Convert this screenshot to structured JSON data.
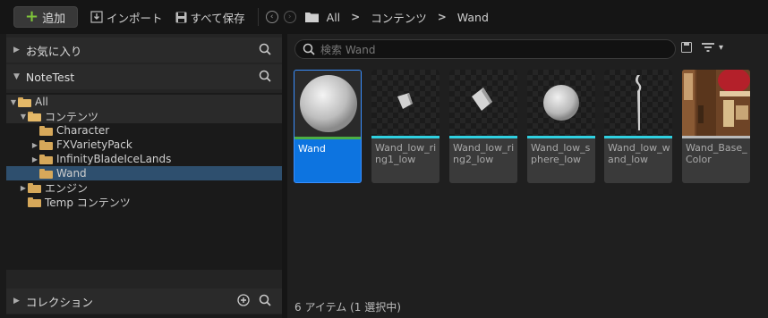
{
  "toolbar": {
    "add_label": "追加",
    "import_label": "インポート",
    "save_all_label": "すべて保存",
    "breadcrumb": [
      "All",
      "コンテンツ",
      "Wand"
    ]
  },
  "favorites": {
    "label": "お気に入り"
  },
  "project": {
    "label": "NoteTest"
  },
  "tree": {
    "all": "All",
    "contents": "コンテンツ",
    "character": "Character",
    "fxvariety": "FXVarietyPack",
    "infinity": "InfinityBladeIceLands",
    "wand": "Wand",
    "engine": "エンジン",
    "temp": "Temp コンテンツ"
  },
  "collections": {
    "label": "コレクション"
  },
  "search": {
    "placeholder": "検索 Wand"
  },
  "assets": [
    {
      "name": "Wand",
      "selected": true
    },
    {
      "name": "Wand_low_ring1_low"
    },
    {
      "name": "Wand_low_ring2_low"
    },
    {
      "name": "Wand_low_sphere_low"
    },
    {
      "name": "Wand_low_wand_low"
    },
    {
      "name": "Wand_Base_Color"
    }
  ],
  "status": "6 アイテム (1 選択中)",
  "colors": {
    "accent": "#0d74e0",
    "mesh_bar": "#2fd0e0",
    "material_bar": "#4cae45",
    "folder": "#d6a85a"
  }
}
